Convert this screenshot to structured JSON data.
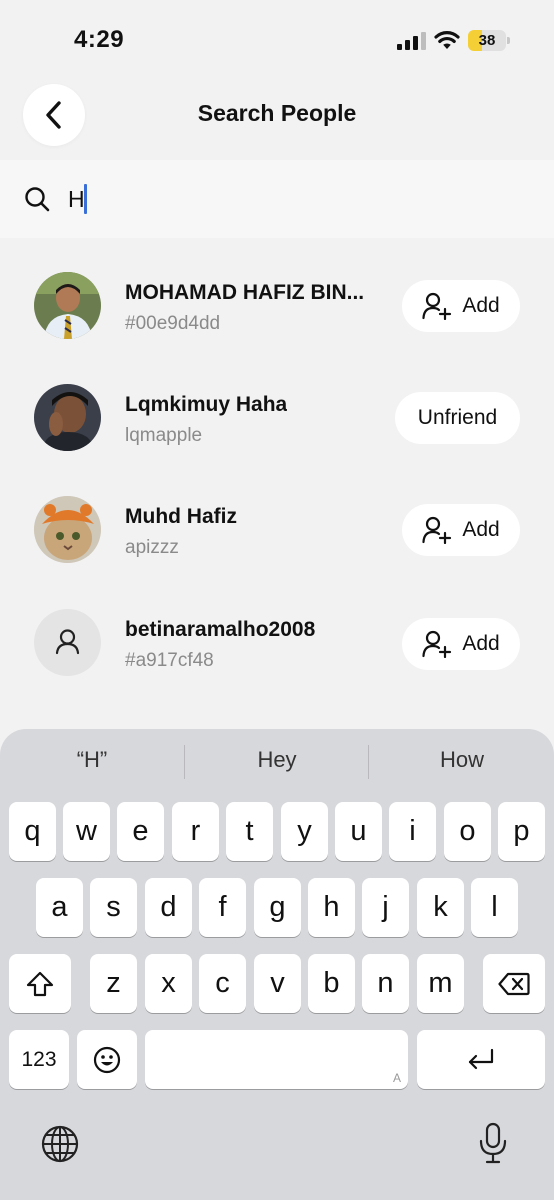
{
  "status_bar": {
    "time": "4:29",
    "battery_level": "38",
    "battery_fraction": 0.38
  },
  "header": {
    "title": "Search People"
  },
  "search": {
    "value": "H"
  },
  "users": [
    {
      "name": "MOHAMAD HAFIZ BIN...",
      "handle": "#00e9d4dd",
      "action": "Add",
      "avatar": "photo"
    },
    {
      "name": "Lqmkimuy Haha",
      "handle": "lqmapple",
      "action": "Unfriend",
      "avatar": "photo"
    },
    {
      "name": "Muhd Hafiz",
      "handle": "apizzz",
      "action": "Add",
      "avatar": "cat-photo"
    },
    {
      "name": "betinaramalho2008",
      "handle": "#a917cf48",
      "action": "Add",
      "avatar": "default-person"
    }
  ],
  "keyboard": {
    "suggestions": [
      "“H”",
      "Hey",
      "How"
    ],
    "row1": [
      "q",
      "w",
      "e",
      "r",
      "t",
      "y",
      "u",
      "i",
      "o",
      "p"
    ],
    "row2": [
      "a",
      "s",
      "d",
      "f",
      "g",
      "h",
      "j",
      "k",
      "l"
    ],
    "row3": [
      "z",
      "x",
      "c",
      "v",
      "b",
      "n",
      "m"
    ],
    "numbers_key": "123",
    "space_hint": "A",
    "icons": {
      "shift": "shift-icon",
      "backspace": "backspace-icon",
      "emoji": "emoji-icon",
      "return": "return-icon",
      "globe": "globe-icon",
      "mic": "microphone-icon"
    }
  },
  "colors": {
    "accent_caret": "#3a6fd8",
    "battery": "#f5cf36",
    "background": "#f2f2f2"
  }
}
